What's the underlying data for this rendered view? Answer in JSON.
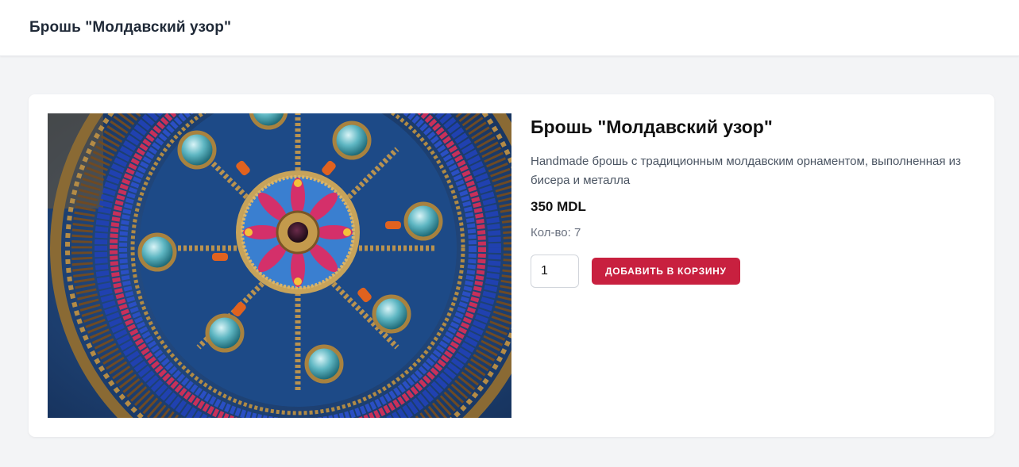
{
  "header": {
    "title": "Брошь \"Молдавский узор\""
  },
  "product": {
    "name": "Брошь \"Молдавский узор\"",
    "description": "Handmade брошь с традиционным молдавским орнаментом, выполненная из бисера и металла",
    "price": "350 MDL",
    "quantity_label": "Кол-во: 7",
    "image_alt": "brooch-photo"
  },
  "actions": {
    "quantity_value": "1",
    "add_to_cart_label": "Добавить в корзину"
  },
  "colors": {
    "accent": "#c8203f",
    "page_bg": "#f3f4f6",
    "card_bg": "#ffffff"
  }
}
